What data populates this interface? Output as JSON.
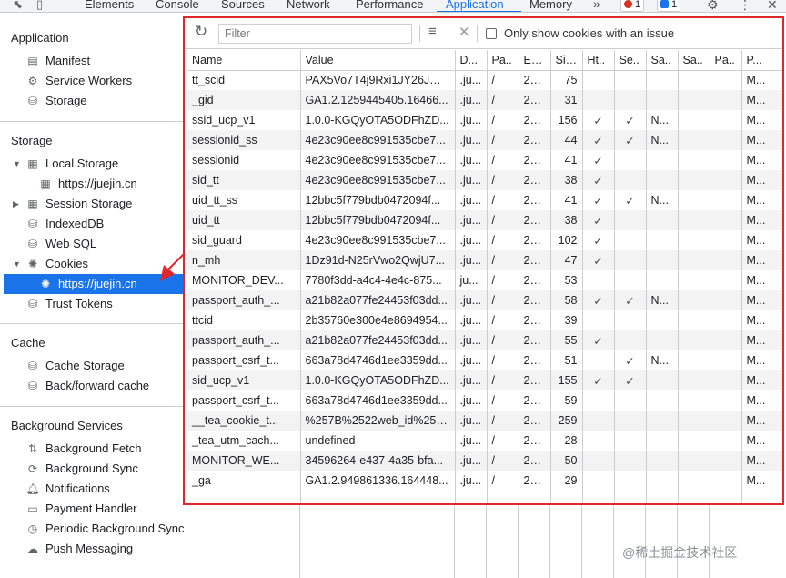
{
  "tabs": [
    "Elements",
    "Console",
    "Sources",
    "Network",
    "Performance",
    "Application",
    "Memory"
  ],
  "active_tab": "Application",
  "badges": {
    "errors": "1",
    "messages": "1"
  },
  "sidebar": {
    "application": {
      "title": "Application",
      "items": [
        "Manifest",
        "Service Workers",
        "Storage"
      ]
    },
    "storage": {
      "title": "Storage",
      "local_storage": "Local Storage",
      "local_storage_child": "https://juejin.cn",
      "session_storage": "Session Storage",
      "indexeddb": "IndexedDB",
      "websql": "Web SQL",
      "cookies": "Cookies",
      "cookies_child": "https://juejin.cn",
      "trust_tokens": "Trust Tokens"
    },
    "cache": {
      "title": "Cache",
      "items": [
        "Cache Storage",
        "Back/forward cache"
      ]
    },
    "background": {
      "title": "Background Services",
      "items": [
        "Background Fetch",
        "Background Sync",
        "Notifications",
        "Payment Handler",
        "Periodic Background Sync",
        "Push Messaging"
      ]
    }
  },
  "toolbar": {
    "filter_placeholder": "Filter",
    "only_issues_label": "Only show cookies with an issue"
  },
  "columns": [
    "Name",
    "Value",
    "D...",
    "Pa..",
    "Ex...",
    "Size",
    "Ht..",
    "Se..",
    "Sa..",
    "Sa..",
    "Pa..",
    "P..."
  ],
  "rows": [
    [
      "tt_scid",
      "PAX5Vo7T4j9Rxi1JY26JMjt...",
      ".ju...",
      "/",
      "20...",
      "75",
      "",
      "",
      "",
      "",
      "",
      "M..."
    ],
    [
      "_gid",
      "GA1.2.1259445405.16466...",
      ".ju...",
      "/",
      "20...",
      "31",
      "",
      "",
      "",
      "",
      "",
      "M..."
    ],
    [
      "ssid_ucp_v1",
      "1.0.0-KGQyOTA5ODFhZD...",
      ".ju...",
      "/",
      "20...",
      "156",
      "✓",
      "✓",
      "N...",
      "",
      "",
      "M..."
    ],
    [
      "sessionid_ss",
      "4e23c90ee8c991535cbe7...",
      ".ju...",
      "/",
      "20...",
      "44",
      "✓",
      "✓",
      "N...",
      "",
      "",
      "M..."
    ],
    [
      "sessionid",
      "4e23c90ee8c991535cbe7...",
      ".ju...",
      "/",
      "20...",
      "41",
      "✓",
      "",
      "",
      "",
      "",
      "M..."
    ],
    [
      "sid_tt",
      "4e23c90ee8c991535cbe7...",
      ".ju...",
      "/",
      "20...",
      "38",
      "✓",
      "",
      "",
      "",
      "",
      "M..."
    ],
    [
      "uid_tt_ss",
      "12bbc5f779bdb0472094f...",
      ".ju...",
      "/",
      "20...",
      "41",
      "✓",
      "✓",
      "N...",
      "",
      "",
      "M..."
    ],
    [
      "uid_tt",
      "12bbc5f779bdb0472094f...",
      ".ju...",
      "/",
      "20...",
      "38",
      "✓",
      "",
      "",
      "",
      "",
      "M..."
    ],
    [
      "sid_guard",
      "4e23c90ee8c991535cbe7...",
      ".ju...",
      "/",
      "20...",
      "102",
      "✓",
      "",
      "",
      "",
      "",
      "M..."
    ],
    [
      "n_mh",
      "1Dz91d-N25rVwo2QwjU7...",
      ".ju...",
      "/",
      "20...",
      "47",
      "✓",
      "",
      "",
      "",
      "",
      "M..."
    ],
    [
      "MONITOR_DEV...",
      "7780f3dd-a4c4-4e4c-875...",
      "ju...",
      "/",
      "20...",
      "53",
      "",
      "",
      "",
      "",
      "",
      "M..."
    ],
    [
      "passport_auth_...",
      "a21b82a077fe24453f03dd...",
      ".ju...",
      "/",
      "20...",
      "58",
      "✓",
      "✓",
      "N...",
      "",
      "",
      "M..."
    ],
    [
      "ttcid",
      "2b35760e300e4e8694954...",
      ".ju...",
      "/",
      "20...",
      "39",
      "",
      "",
      "",
      "",
      "",
      "M..."
    ],
    [
      "passport_auth_...",
      "a21b82a077fe24453f03dd...",
      ".ju...",
      "/",
      "20...",
      "55",
      "✓",
      "",
      "",
      "",
      "",
      "M..."
    ],
    [
      "passport_csrf_t...",
      "663a78d4746d1ee3359dd...",
      ".ju...",
      "/",
      "20...",
      "51",
      "",
      "✓",
      "N...",
      "",
      "",
      "M..."
    ],
    [
      "sid_ucp_v1",
      "1.0.0-KGQyOTA5ODFhZD...",
      ".ju...",
      "/",
      "20...",
      "155",
      "✓",
      "✓",
      "",
      "",
      "",
      "M..."
    ],
    [
      "passport_csrf_t...",
      "663a78d4746d1ee3359dd...",
      ".ju...",
      "/",
      "20...",
      "59",
      "",
      "",
      "",
      "",
      "",
      "M..."
    ],
    [
      "__tea_cookie_t...",
      "%257B%2522web_id%252...",
      ".ju...",
      "/",
      "20...",
      "259",
      "",
      "",
      "",
      "",
      "",
      "M..."
    ],
    [
      "_tea_utm_cach...",
      "undefined",
      ".ju...",
      "/",
      "20...",
      "28",
      "",
      "",
      "",
      "",
      "",
      "M..."
    ],
    [
      "MONITOR_WE...",
      "34596264-e437-4a35-bfa...",
      ".ju...",
      "/",
      "20...",
      "50",
      "",
      "",
      "",
      "",
      "",
      "M..."
    ],
    [
      "_ga",
      "GA1.2.949861336.164448...",
      ".ju...",
      "/",
      "20...",
      "29",
      "",
      "",
      "",
      "",
      "",
      "M..."
    ]
  ],
  "watermark": "@稀土掘金技术社区",
  "colors": {
    "accent": "#1a73e8",
    "highlight_border": "#e0282a"
  }
}
